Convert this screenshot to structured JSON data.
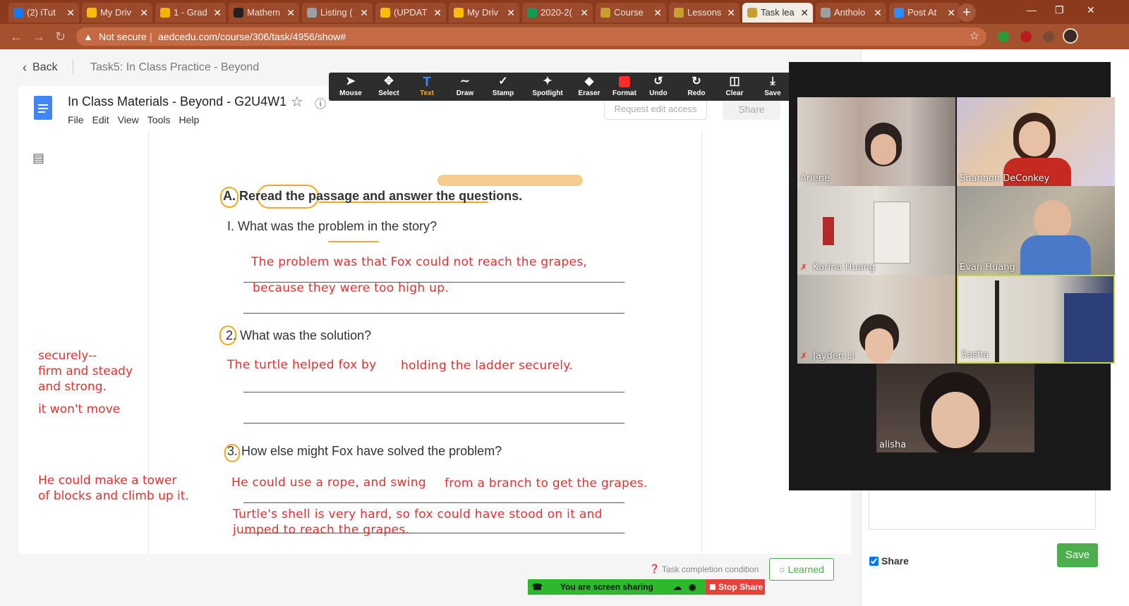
{
  "browser": {
    "tabs": [
      {
        "label": "(2) iTut",
        "color": "#1877f2"
      },
      {
        "label": "My Driv",
        "color": "#fbbc04"
      },
      {
        "label": "1 - Grad",
        "color": "#f4b400"
      },
      {
        "label": "Mathem",
        "color": "#222222"
      },
      {
        "label": "Listing (",
        "color": "#9aa0a6"
      },
      {
        "label": "(UPDAT",
        "color": "#fbbc04"
      },
      {
        "label": "My Driv",
        "color": "#fbbc04"
      },
      {
        "label": "2020-2(",
        "color": "#0f9d58"
      },
      {
        "label": "Course",
        "color": "#c8a030"
      },
      {
        "label": "Lessons",
        "color": "#c8a030"
      },
      {
        "label": "Task lea",
        "color": "#c8a030"
      },
      {
        "label": "Antholo",
        "color": "#9aa0a6"
      },
      {
        "label": "Post At",
        "color": "#2d8cff"
      }
    ],
    "security": "Not secure",
    "url": "aedcedu.com/course/306/task/4956/show#"
  },
  "header": {
    "back": "Back",
    "task_title": "Task5:  In Class Practice - Beyond"
  },
  "doc": {
    "title": "In Class Materials - Beyond - G2U4W1",
    "menu": [
      "File",
      "Edit",
      "View",
      "Tools",
      "Help"
    ],
    "request_access": "Request edit access",
    "share": "Share",
    "section_a": "A. Reread the passage and answer the questions.",
    "q1": "I.  What was the problem in the story?",
    "q1_ans1": "The problem was that Fox could not reach the grapes,",
    "q1_ans2": "because they were too high up.",
    "q2": "2.  What was the solution?",
    "q2_ans1a": "The turtle helped fox by",
    "q2_ans1b": "holding the ladder securely.",
    "q3": "3.  How else might Fox have solved the problem?",
    "q3_ans1a": "He could use a rope, and swing",
    "q3_ans1b": "from a branch to get the grapes.",
    "q3_ans2": "Turtle's shell is very hard, so fox could have stood on it and",
    "q3_ans3": "jumped to reach the grapes.",
    "side_note1": [
      "securely--",
      "firm and steady",
      "and strong."
    ],
    "side_note2": "it won't move",
    "side_note3": [
      "He could make a tower",
      "of blocks and climb up it."
    ]
  },
  "zoom_toolbar": {
    "tools": [
      {
        "label": "Mouse",
        "icon": "cursor-icon"
      },
      {
        "label": "Select",
        "icon": "move-icon"
      },
      {
        "label": "Text",
        "icon": "text-icon"
      },
      {
        "label": "Draw",
        "icon": "draw-icon"
      },
      {
        "label": "Stamp",
        "icon": "stamp-icon"
      },
      {
        "label": "Spotlight",
        "icon": "spotlight-icon"
      },
      {
        "label": "Eraser",
        "icon": "eraser-icon"
      },
      {
        "label": "Format",
        "icon": "format-icon"
      },
      {
        "label": "Undo",
        "icon": "undo-icon"
      },
      {
        "label": "Redo",
        "icon": "redo-icon"
      },
      {
        "label": "Clear",
        "icon": "trash-icon"
      },
      {
        "label": "Save",
        "icon": "save-icon"
      }
    ],
    "active_color": "#f9a825"
  },
  "zoom_gallery": {
    "participants": [
      {
        "name": "Arlene",
        "muted": false
      },
      {
        "name": "Shannon DeConkey",
        "muted": false
      },
      {
        "name": "Karina Huang",
        "muted": true
      },
      {
        "name": "Evan Huang",
        "muted": false
      },
      {
        "name": "Jayden Li",
        "muted": true
      },
      {
        "name": "Sasha",
        "muted": false
      },
      {
        "name": "alisha",
        "muted": false
      }
    ]
  },
  "footer": {
    "completion": "Task completion condition",
    "learned": "Learned",
    "sharing": "You are screen sharing",
    "stop_share": "Stop Share",
    "share_checkbox": "Share",
    "save": "Save"
  },
  "colors": {
    "annotation_red": "#e53030",
    "highlight_orange": "#f5a623",
    "zoom_green": "#2eb82e",
    "save_green": "#4cae4c"
  }
}
